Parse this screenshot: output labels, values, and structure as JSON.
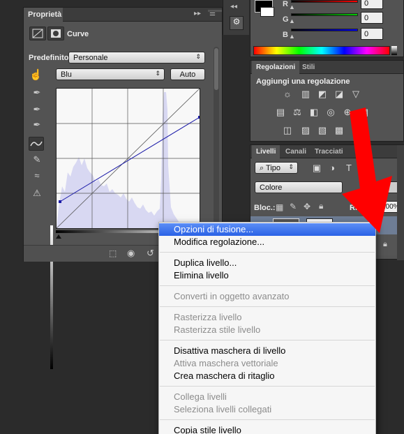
{
  "properties_panel": {
    "tab_label": "Proprietà",
    "adjustment_name": "Curve",
    "preset_label": "Predefinito:",
    "preset_value": "Personale",
    "channel_value": "Blu",
    "auto_button": "Auto"
  },
  "color_panel": {
    "r_label": "R",
    "g_label": "G",
    "b_label": "B",
    "r_value": "0",
    "g_value": "0",
    "b_value": "0"
  },
  "adjustments_panel": {
    "tabs": [
      "Regolazioni",
      "Stili"
    ],
    "heading": "Aggiungi una regolazione"
  },
  "layers_panel": {
    "tabs": [
      "Livelli",
      "Canali",
      "Tracciati"
    ],
    "kind_filter": "Tipo",
    "blend_mode": "Colore",
    "lock_label": "Bloc.:",
    "opacity_label_partial": "Ri",
    "opacity_value": "100%"
  },
  "context_menu": {
    "groups": [
      [
        {
          "label": "Opzioni di fusione...",
          "enabled": true,
          "highlighted": true
        },
        {
          "label": "Modifica regolazione...",
          "enabled": true
        }
      ],
      [
        {
          "label": "Duplica livello...",
          "enabled": true
        },
        {
          "label": "Elimina livello",
          "enabled": true
        }
      ],
      [
        {
          "label": "Converti in oggetto avanzato",
          "enabled": false
        }
      ],
      [
        {
          "label": "Rasterizza livello",
          "enabled": false
        },
        {
          "label": "Rasterizza stile livello",
          "enabled": false
        }
      ],
      [
        {
          "label": "Disattiva maschera di livello",
          "enabled": true
        },
        {
          "label": "Attiva maschera vettoriale",
          "enabled": false
        },
        {
          "label": "Crea maschera di ritaglio",
          "enabled": true
        }
      ],
      [
        {
          "label": "Collega livelli",
          "enabled": false
        },
        {
          "label": "Seleziona livelli collegati",
          "enabled": false
        }
      ],
      [
        {
          "label": "Copia stile livello",
          "enabled": true
        }
      ]
    ]
  },
  "colors": {
    "highlight": "#2a62e6",
    "arrow": "#ff0000",
    "curve_line": "#1a1aa8",
    "histogram": "#d8d8f2"
  }
}
